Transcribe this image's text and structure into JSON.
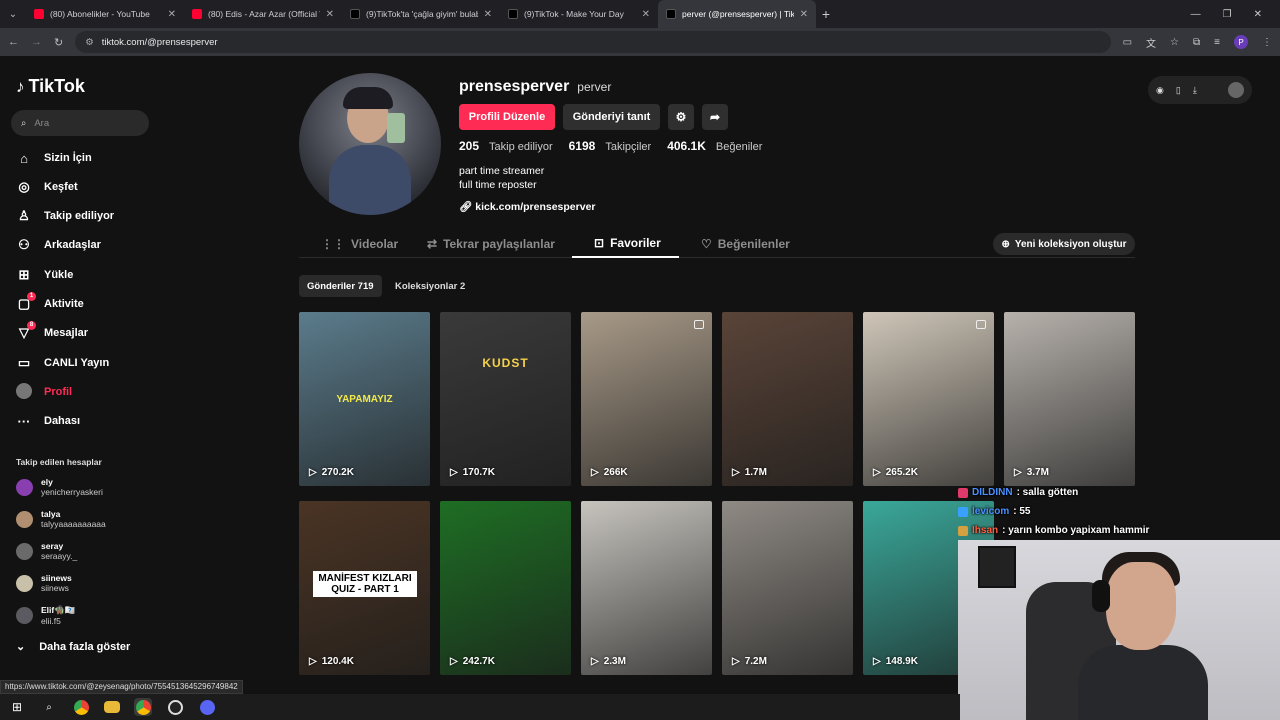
{
  "browser": {
    "tabs": [
      {
        "title": "(80) Abonelikler - YouTube",
        "color": "#ff0033"
      },
      {
        "title": "(80) Edis - Azar Azar (Official Vi",
        "color": "#ff0033"
      },
      {
        "title": "(9)TikTok'ta 'çağla giyim' bulab",
        "color": "#000000"
      },
      {
        "title": "(9)TikTok - Make Your Day",
        "color": "#000000"
      },
      {
        "title": "perver (@prensesperver) | TikTo",
        "color": "#000000"
      }
    ],
    "url": "tiktok.com/@prensesperver",
    "profile_initial": "P"
  },
  "sidebar": {
    "logo": "TikTok",
    "search_placeholder": "Ara",
    "items": [
      {
        "label": "Sizin İçin",
        "icon": "home-icon",
        "glyph": "⌂"
      },
      {
        "label": "Keşfet",
        "icon": "compass-icon",
        "glyph": "◎"
      },
      {
        "label": "Takip ediliyor",
        "icon": "following-icon",
        "glyph": "♙"
      },
      {
        "label": "Arkadaşlar",
        "icon": "friends-icon",
        "glyph": "⚇"
      },
      {
        "label": "Yükle",
        "icon": "upload-icon",
        "glyph": "⊞"
      },
      {
        "label": "Aktivite",
        "icon": "activity-icon",
        "glyph": "▢",
        "badge": "1"
      },
      {
        "label": "Mesajlar",
        "icon": "messages-icon",
        "glyph": "▽",
        "badge": "8"
      },
      {
        "label": "CANLI Yayın",
        "icon": "live-icon",
        "glyph": "▭"
      },
      {
        "label": "Profil",
        "icon": "profile-icon",
        "glyph": "●"
      },
      {
        "label": "Dahası",
        "icon": "more-icon",
        "glyph": "···"
      }
    ],
    "following_title": "Takip edilen hesaplar",
    "following": [
      {
        "name": "ely",
        "handle": "yenicherryaskeri",
        "color": "#8a3fb0"
      },
      {
        "name": "talya",
        "handle": "talyyaaaaaaaaaa",
        "color": "#b08e70"
      },
      {
        "name": "seray",
        "handle": "seraayy._",
        "color": "#6a6a6a"
      },
      {
        "name": "siinews",
        "handle": "siinews",
        "color": "#c8c0a8"
      },
      {
        "name": "Elif🧌🇽🇽",
        "handle": "elii.f5",
        "color": "#5a5a60"
      }
    ],
    "show_more": "Daha fazla göster"
  },
  "profile": {
    "username": "prensesperver",
    "nickname": "perver",
    "edit_button": "Profili Düzenle",
    "promote_button": "Gönderiyi tanıt",
    "stats": {
      "following_count": "205",
      "following_label": "Takip ediliyor",
      "followers_count": "6198",
      "followers_label": "Takipçiler",
      "likes_count": "406.1K",
      "likes_label": "Beğeniler"
    },
    "bio_line1": "part time streamer",
    "bio_line2": "full time reposter",
    "link": "kick.com/prensesperver"
  },
  "tabs": {
    "videos": "Videolar",
    "reposts": "Tekrar paylaşılanlar",
    "favorites": "Favoriler",
    "liked": "Beğenilenler",
    "new_collection": "Yeni koleksiyon oluştur"
  },
  "subtabs": {
    "posts": "Gönderiler 719",
    "collections": "Koleksiyonlar 2"
  },
  "videos": [
    {
      "views": "270.2K",
      "overlay": "YAPAMAYIZ",
      "bg": "#5b7c8c"
    },
    {
      "views": "170.7K",
      "overlay": "KUDST",
      "bg": "#3a3a3a"
    },
    {
      "views": "266K",
      "overlay": "",
      "bg": "#a89a88"
    },
    {
      "views": "1.7M",
      "overlay": "",
      "bg": "#5a4438"
    },
    {
      "views": "265.2K",
      "overlay": "",
      "bg": "#cfc6b8"
    },
    {
      "views": "3.7M",
      "overlay": "",
      "bg": "#b7b2ac"
    },
    {
      "views": "120.4K",
      "overlay": "MANİFEST KIZLARI QUIZ - PART 1",
      "bg": "#4a3424"
    },
    {
      "views": "242.7K",
      "overlay": "",
      "bg": "#1e6e24"
    },
    {
      "views": "2.3M",
      "overlay": "",
      "bg": "#c7c4be"
    },
    {
      "views": "7.2M",
      "overlay": "",
      "bg": "#8f8a84"
    },
    {
      "views": "148.9K",
      "overlay": "",
      "bg": "#3aa89a"
    }
  ],
  "status_url": "https://www.tiktok.com/@zeysenag/photo/7554513645296749842",
  "chat": [
    {
      "user": "DILDINN",
      "msg": ": salla götten",
      "color": "#4a90ff",
      "icon_color": "#e03a6a"
    },
    {
      "user": "levicom",
      "msg": ": 55",
      "color": "#4a90ff",
      "icon_color": "#3aa0ff"
    },
    {
      "user": "Ihsan",
      "msg": ": yarın kombo yapixam hammir",
      "color": "#ff6040",
      "icon_color": "#d4a040"
    }
  ]
}
